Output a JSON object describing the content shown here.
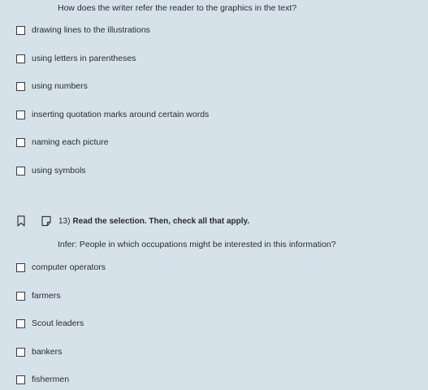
{
  "question12": {
    "prompt": "How does the writer refer the reader to the graphics in the text?",
    "options": [
      {
        "label": "drawing lines to the illustrations"
      },
      {
        "label": "using letters in parentheses"
      },
      {
        "label": "using numbers"
      },
      {
        "label": "inserting quotation marks around certain words"
      },
      {
        "label": "naming each picture"
      },
      {
        "label": "using symbols"
      }
    ]
  },
  "question13": {
    "number": "13)",
    "instruction": "Read the selection. Then, check all that apply.",
    "prompt": "Infer: People in which occupations might be interested in this information?",
    "options": [
      {
        "label": "computer operators"
      },
      {
        "label": "farmers"
      },
      {
        "label": "Scout leaders"
      },
      {
        "label": "bankers"
      },
      {
        "label": "fishermen"
      }
    ]
  },
  "icons": {
    "bookmark": "bookmark-icon",
    "note": "note-icon"
  }
}
